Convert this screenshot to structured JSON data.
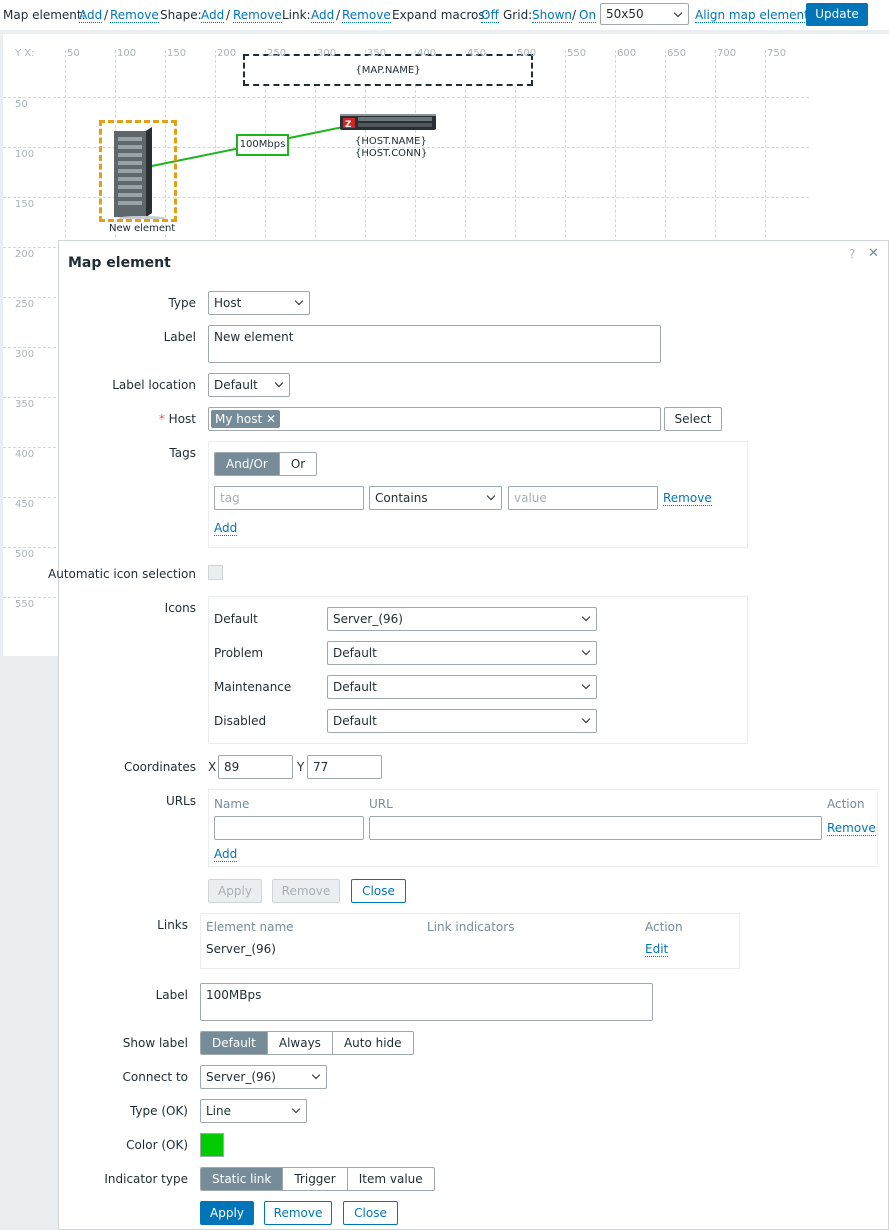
{
  "toolbar": {
    "map_element": "Map element:",
    "shape": "Shape:",
    "link": "Link:",
    "add": "Add",
    "remove": "Remove",
    "slash": "/",
    "expand_macros": "Expand macros:",
    "off": "Off",
    "grid": "Grid:",
    "shown": "Shown",
    "on": "On",
    "grid_size": "50x50",
    "align": "Align map elements",
    "update": "Update"
  },
  "map": {
    "axis_x_label": "Y X:",
    "x_ticks": [
      "50",
      "100",
      "150",
      "200",
      "250",
      "300",
      "350",
      "400",
      "450",
      "500",
      "550",
      "600",
      "650",
      "700",
      "750"
    ],
    "y_ticks": [
      "50",
      "100",
      "150",
      "200",
      "250",
      "300",
      "350",
      "400",
      "450",
      "500",
      "550"
    ],
    "map_name": "{MAP.NAME}",
    "link_label": "100Mbps",
    "host_name": "{HOST.NAME}",
    "host_conn": "{HOST.CONN}",
    "element_label": "New element",
    "colors": {
      "link": "#1db51d",
      "selection": "#e0a117"
    }
  },
  "dialog": {
    "title": "Map element",
    "help": "?",
    "close": "✕",
    "type_label": "Type",
    "type_value": "Host",
    "label_label": "Label",
    "label_value": "New element",
    "label_location_label": "Label location",
    "label_location_value": "Default",
    "host_label": "Host",
    "required": "*",
    "host_chip": "My host",
    "host_chip_x": "✕",
    "select": "Select",
    "tags_label": "Tags",
    "and_or": "And/Or",
    "or": "Or",
    "tag_placeholder": "tag",
    "operator": "Contains",
    "value_placeholder": "value",
    "remove": "Remove",
    "add": "Add",
    "auto_icon_label": "Automatic icon selection",
    "icons_label": "Icons",
    "icons": [
      {
        "name": "Default",
        "value": "Server_(96)"
      },
      {
        "name": "Problem",
        "value": "Default"
      },
      {
        "name": "Maintenance",
        "value": "Default"
      },
      {
        "name": "Disabled",
        "value": "Default"
      }
    ],
    "coordinates_label": "Coordinates",
    "x_label": "X",
    "x_value": "89",
    "y_label": "Y",
    "y_value": "77",
    "urls_label": "URLs",
    "url_headers": {
      "name": "Name",
      "url": "URL",
      "action": "Action"
    },
    "apply": "Apply",
    "close_btn": "Close",
    "links_label": "Links",
    "links_headers": {
      "element": "Element name",
      "indicators": "Link indicators",
      "action": "Action"
    },
    "links_row": {
      "element": "Server_(96)",
      "action": "Edit"
    },
    "link_label_label": "Label",
    "link_label_value": "100MBps",
    "show_label_label": "Show label",
    "show_label_options": [
      "Default",
      "Always",
      "Auto hide"
    ],
    "connect_to_label": "Connect to",
    "connect_to_value": "Server_(96)",
    "type_ok_label": "Type (OK)",
    "type_ok_value": "Line",
    "color_ok_label": "Color (OK)",
    "color_ok_value": "#00cc00",
    "indicator_type_label": "Indicator type",
    "indicator_options": [
      "Static link",
      "Trigger",
      "Item value"
    ]
  }
}
